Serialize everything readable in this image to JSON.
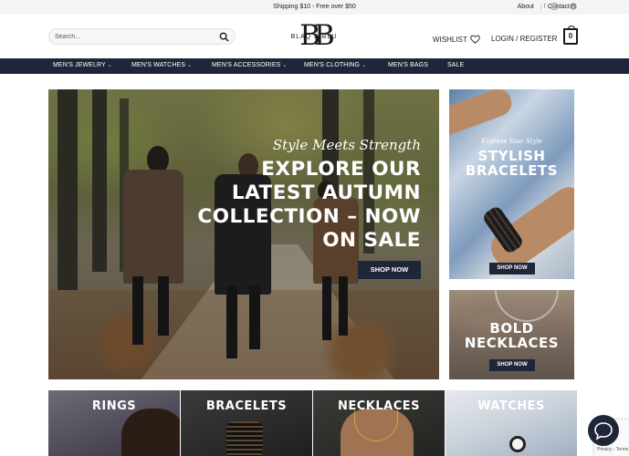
{
  "topbar": {
    "shipping": "Shipping $10 - Free over $50",
    "about": "About",
    "contact": "Contact",
    "social_icons": [
      "facebook-icon",
      "instagram-icon",
      "tiktok-icon",
      "pinterest-icon"
    ]
  },
  "header": {
    "search_placeholder": "Search...",
    "logo_mark": "BB",
    "logo_text": "BLAQ & BLU",
    "wishlist": "WISHLIST",
    "login": "LOGIN / REGISTER",
    "cart_count": "0"
  },
  "nav": {
    "items": [
      {
        "label": "MEN'S JEWELRY",
        "dropdown": true
      },
      {
        "label": "MEN'S WATCHES",
        "dropdown": true
      },
      {
        "label": "MEN'S ACCESSORIES",
        "dropdown": true
      },
      {
        "label": "MEN'S CLOTHING",
        "dropdown": true
      },
      {
        "label": "MEN'S BAGS",
        "dropdown": false
      },
      {
        "label": "SALE",
        "dropdown": false
      }
    ]
  },
  "hero": {
    "script": "Style Meets Strength",
    "title": "EXPLORE OUR LATEST AUTUMN COLLECTION – NOW ON SALE",
    "button": "SHOP NOW"
  },
  "promos": [
    {
      "script": "Express Your Style",
      "title": "STYLISH BRACELETS",
      "button": "SHOP NOW"
    },
    {
      "title": "BOLD NECKLACES",
      "button": "SHOP NOW"
    }
  ],
  "categories": [
    {
      "label": "RINGS"
    },
    {
      "label": "BRACELETS"
    },
    {
      "label": "NECKLACES"
    },
    {
      "label": "WATCHES"
    }
  ],
  "recaptcha": "Privacy - Terms",
  "colors": {
    "navy": "#20263a",
    "white": "#ffffff"
  }
}
